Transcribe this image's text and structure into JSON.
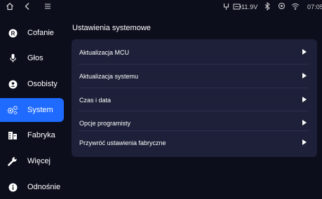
{
  "status_bar": {
    "icons": [
      "home-icon",
      "back-icon",
      "menu-icon",
      "usb-icon",
      "battery-icon",
      "bluetooth-icon",
      "location-icon",
      "wifi-icon"
    ],
    "voltage": "11.9V",
    "time": "07:05"
  },
  "sidebar": {
    "items": [
      {
        "label": "Cofanie",
        "icon": "reverse-r-icon",
        "active": false
      },
      {
        "label": "Głos",
        "icon": "microphone-icon",
        "active": false
      },
      {
        "label": "Osobisty",
        "icon": "personal-icon",
        "active": false
      },
      {
        "label": "System",
        "icon": "system-gears-icon",
        "active": true
      },
      {
        "label": "Fabryka",
        "icon": "factory-icon",
        "active": false
      },
      {
        "label": "Więcej",
        "icon": "wrench-icon",
        "active": false
      },
      {
        "label": "Odnośnie",
        "icon": "info-icon",
        "active": false
      }
    ]
  },
  "main": {
    "title": "Ustawienia systemowe",
    "rows": [
      {
        "label": "Aktualizacja MCU"
      },
      {
        "label": "Aktualizacja systemu"
      },
      {
        "label": "Czas i data"
      },
      {
        "label": "Opcje programisty"
      },
      {
        "label": "Przywróć ustawienia fabryczne"
      }
    ]
  },
  "colors": {
    "background": "#0c0e1c",
    "panel": "#1d2038",
    "accent": "#1f6bff"
  }
}
